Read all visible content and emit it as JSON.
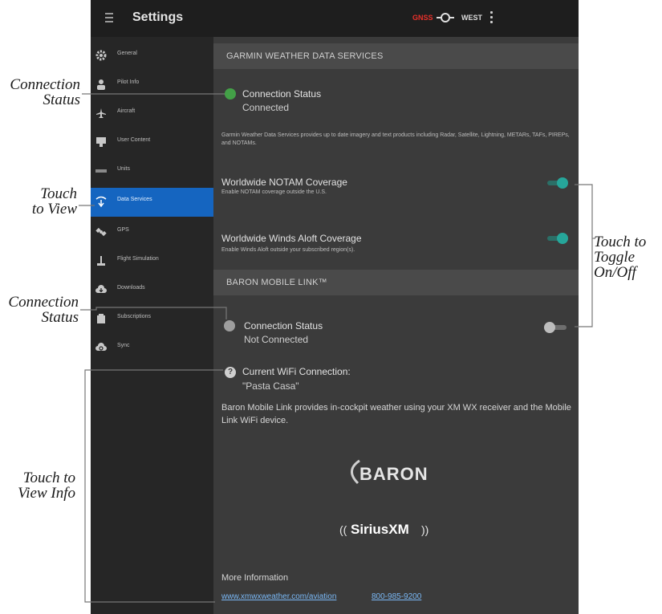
{
  "callouts": {
    "connection_status_1": [
      "Connection",
      "Status"
    ],
    "touch_to_view": [
      "Touch",
      "to View"
    ],
    "connection_status_2": [
      "Connection",
      "Status"
    ],
    "touch_to_view_info": [
      "Touch to",
      "View Info"
    ],
    "touch_to_toggle": [
      "Touch to",
      "Toggle",
      "On/Off"
    ]
  },
  "topbar": {
    "title": "Settings",
    "gps_status": "GNSS",
    "wx_label": "WEST"
  },
  "sidebar": {
    "items": [
      {
        "label": "General",
        "icon": "gear-icon"
      },
      {
        "label": "Pilot Info",
        "icon": "person-icon"
      },
      {
        "label": "Aircraft",
        "icon": "airplane-icon"
      },
      {
        "label": "User Content",
        "icon": "database-icon"
      },
      {
        "label": "Units",
        "icon": "ruler-icon"
      },
      {
        "label": "Data Services",
        "icon": "data-signal-icon",
        "active": true
      },
      {
        "label": "GPS",
        "icon": "satellite-icon"
      },
      {
        "label": "Flight Simulation",
        "icon": "joystick-icon"
      },
      {
        "label": "Downloads",
        "icon": "cloud-download-icon"
      },
      {
        "label": "Subscriptions",
        "icon": "subscriptions-icon"
      },
      {
        "label": "Sync",
        "icon": "cloud-sync-icon"
      }
    ]
  },
  "garmin": {
    "header": "GARMIN WEATHER DATA SERVICES",
    "status_label": "Connection Status",
    "status_value": "Connected",
    "description": "Garmin Weather Data Services provides up to date imagery and text products including Radar, Satellite, Lightning, METARs, TAFs, PIREPs, and NOTAMs.",
    "notam_title": "Worldwide NOTAM Coverage",
    "notam_sub": "Enable NOTAM coverage outside the U.S.",
    "winds_title": "Worldwide Winds Aloft Coverage",
    "winds_sub": "Enable Winds Aloft outside your subscribed region(s)."
  },
  "baron": {
    "header": "BARON MOBILE LINK™",
    "status_label": "Connection Status",
    "status_value": "Not Connected",
    "wifi_label": "Current WiFi Connection:",
    "wifi_value": "\"Pasta Casa\"",
    "description": "Baron Mobile Link provides in-cockpit weather using your XM WX receiver and the Mobile Link WiFi device.",
    "baron_logo_text": "BARON",
    "sirius_logo_text": "SiriusXM",
    "more_info": "More Information",
    "link": "www.xmwxweather.com/aviation",
    "phone": "800-985-9200"
  },
  "colors": {
    "accent": "#1565c0",
    "toggle_on": "#26a69a",
    "status_connected": "#43a047",
    "status_disconnected": "#9e9e9e"
  }
}
